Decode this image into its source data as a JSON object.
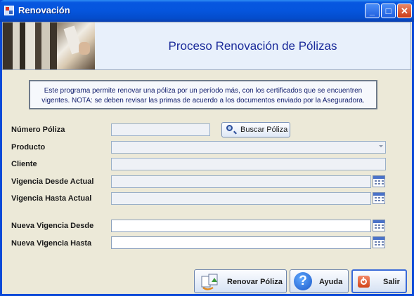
{
  "window": {
    "title": "Renovación"
  },
  "header": {
    "title": "Proceso Renovación de Pólizas"
  },
  "info": {
    "text": "Este programa permite renovar una póliza por un período más, con los certificados que se encuentren vigentes. NOTA: se deben revisar las primas de acuerdo a los documentos enviado por la Aseguradora."
  },
  "form": {
    "numero_poliza": {
      "label": "Número Póliza",
      "value": ""
    },
    "buscar_label": "Buscar Póliza",
    "producto": {
      "label": "Producto",
      "value": ""
    },
    "cliente": {
      "label": "Cliente",
      "value": ""
    },
    "vigencia_desde_actual": {
      "label": "Vigencia Desde Actual",
      "value": ""
    },
    "vigencia_hasta_actual": {
      "label": "Vigencia Hasta Actual",
      "value": ""
    },
    "nueva_vigencia_desde": {
      "label": "Nueva Vigencia Desde",
      "value": ""
    },
    "nueva_vigencia_hasta": {
      "label": "Nueva Vigencia Hasta",
      "value": ""
    }
  },
  "buttons": {
    "renovar": "Renovar Póliza",
    "ayuda": "Ayuda",
    "salir": "Salir"
  }
}
